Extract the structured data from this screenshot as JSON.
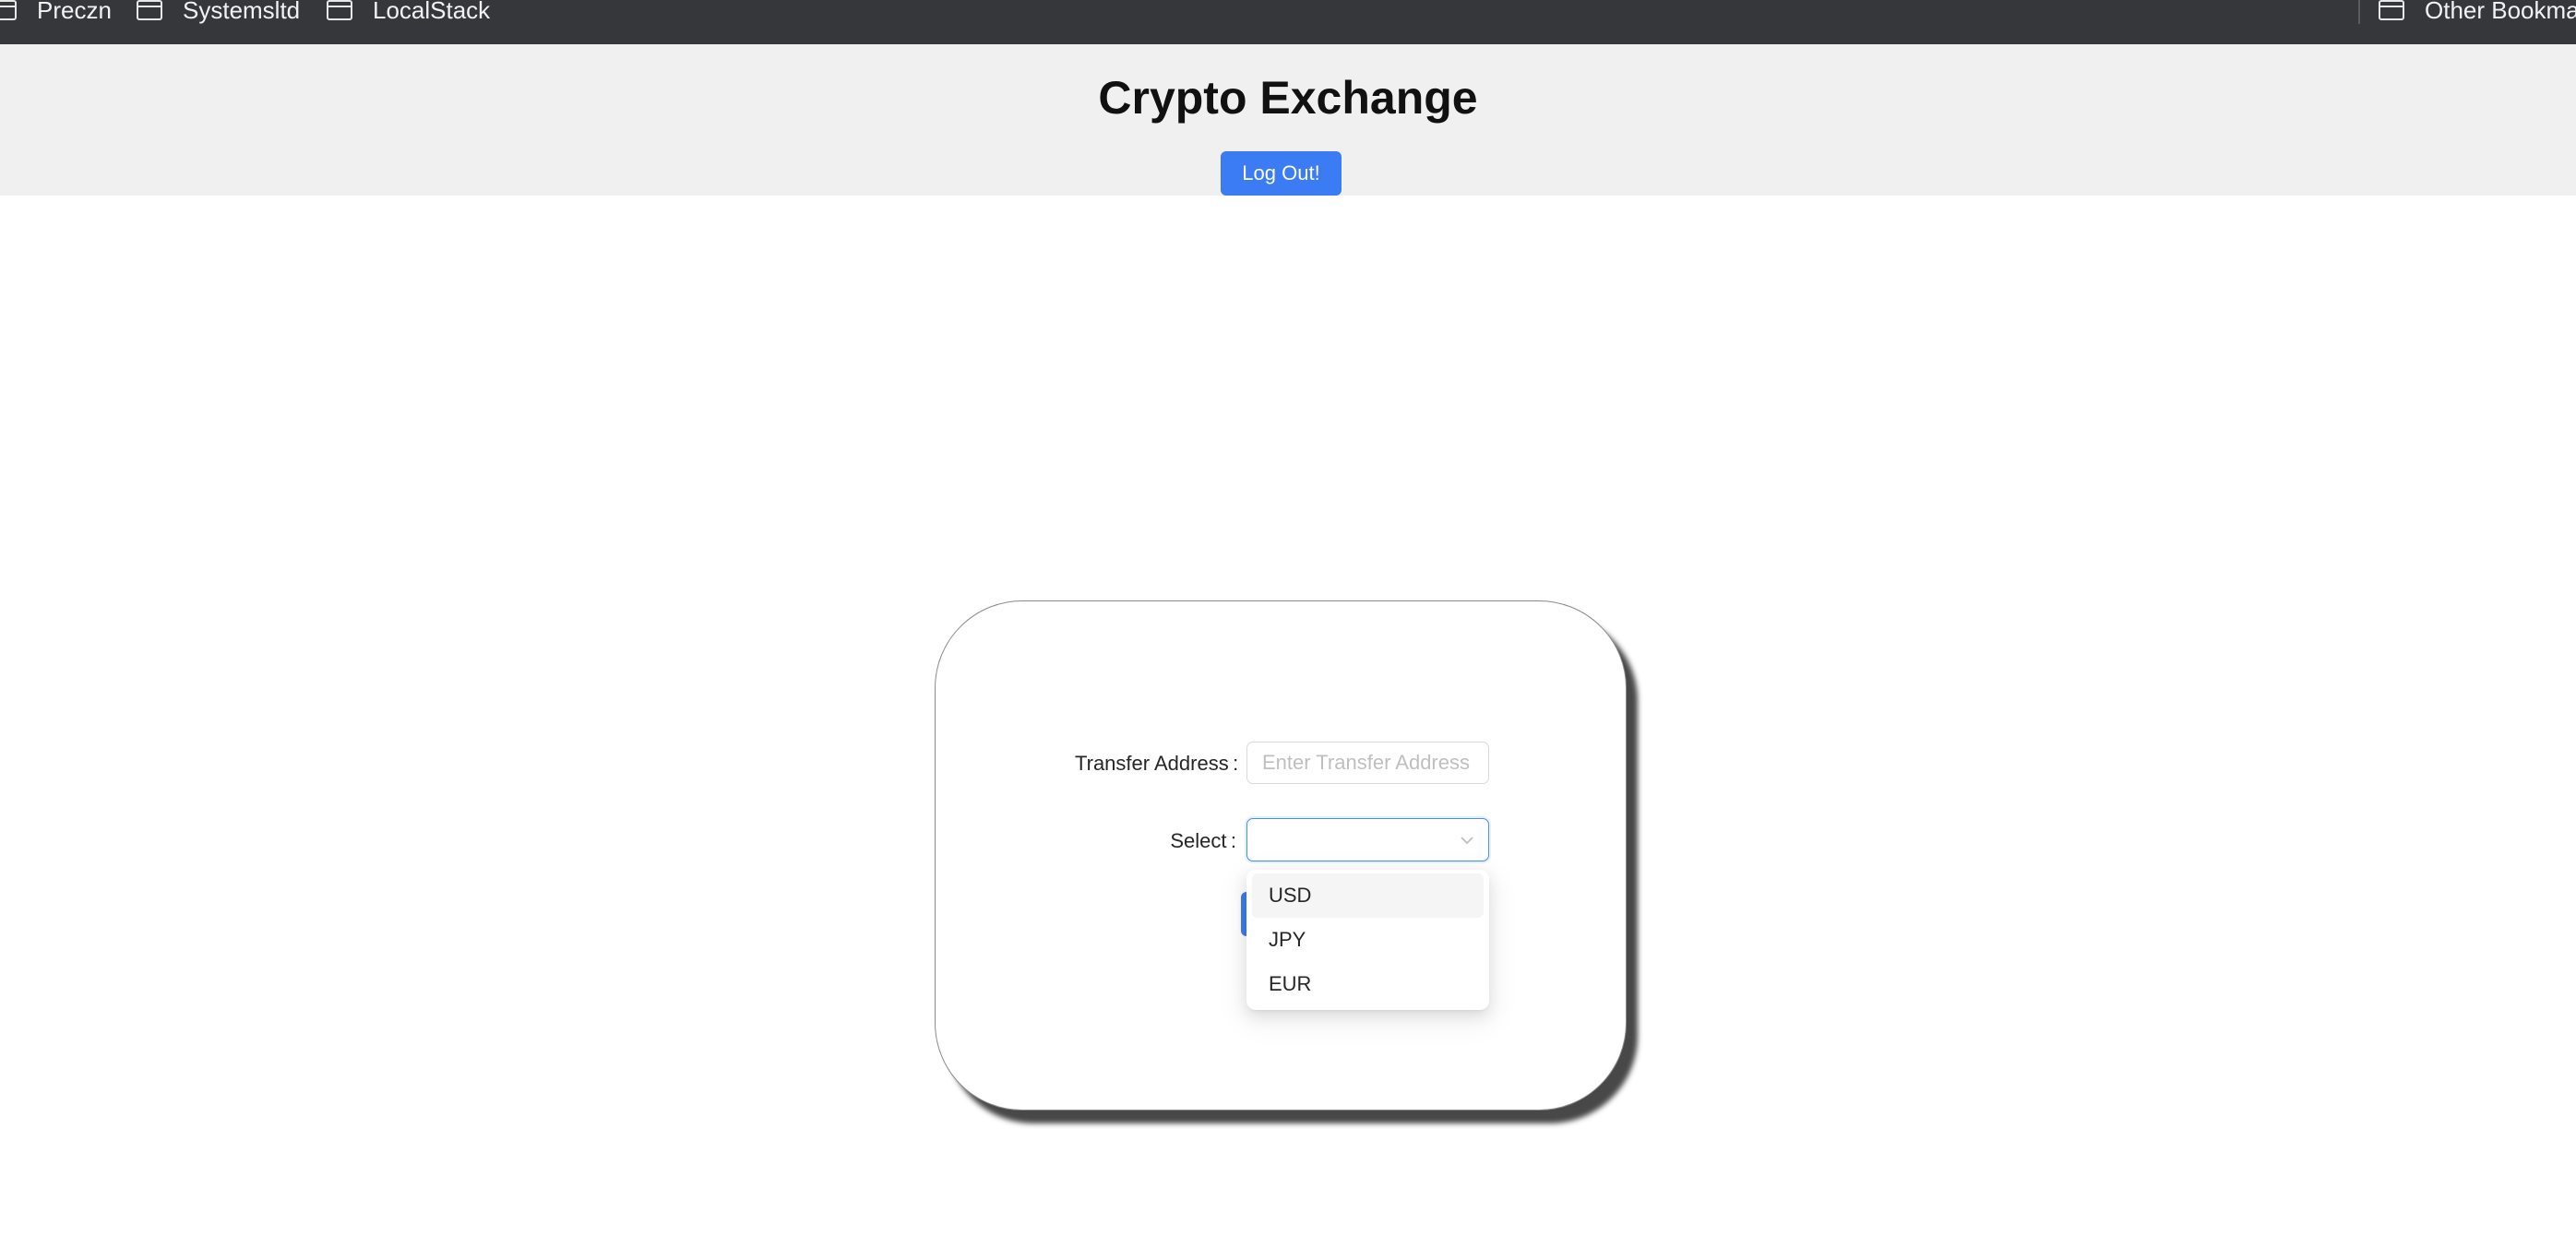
{
  "bookmarks_bar": {
    "items": [
      {
        "label": "Preczn",
        "icon": "folder-icon"
      },
      {
        "label": "Systemsltd",
        "icon": "folder-icon"
      },
      {
        "label": "LocalStack",
        "icon": "folder-icon"
      }
    ],
    "other_bookmarks": {
      "label": "Other Bookmarks",
      "icon": "folder-icon"
    }
  },
  "header": {
    "title": "Crypto Exchange",
    "logout_label": "Log Out!"
  },
  "form": {
    "address_label": "Transfer Address",
    "address_placeholder": "Enter Transfer Address",
    "address_value": "",
    "select_label": "Select",
    "select_value": "",
    "options": [
      "USD",
      "JPY",
      "EUR"
    ],
    "highlighted_option": "USD"
  },
  "colors": {
    "bookmarks_bar_bg": "#36373b",
    "header_bg": "#f0f0f0",
    "primary_button": "#3b7cf4",
    "select_focus_border": "#4b8df8"
  }
}
